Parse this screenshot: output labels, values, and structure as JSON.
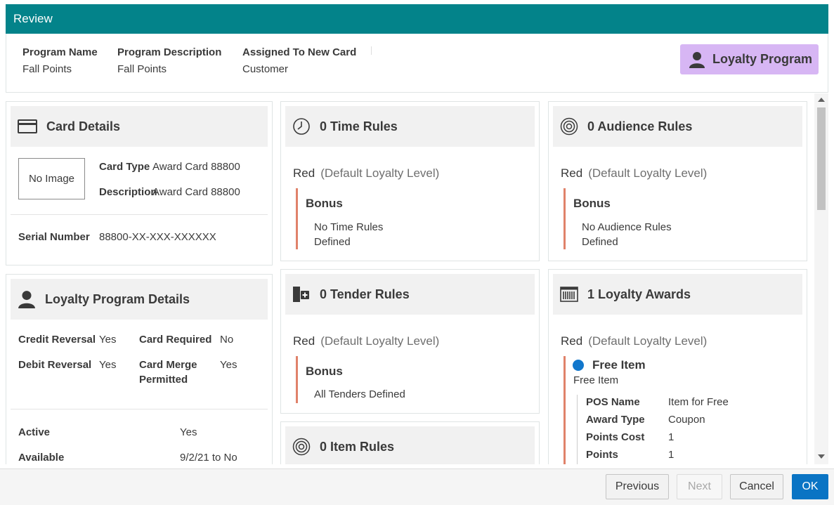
{
  "dialog": {
    "title": "Review"
  },
  "summary": {
    "program_name_label": "Program Name",
    "program_name": "Fall Points",
    "program_description_label": "Program Description",
    "program_description": "Fall Points",
    "assigned_label": "Assigned To New Card",
    "assigned_value": "Customer",
    "badge_label": "Loyalty Program",
    "badge_color": "#d7b6f4"
  },
  "card_details": {
    "title": "Card Details",
    "icon": "credit-card-icon",
    "image_placeholder": "No Image",
    "card_type_label": "Card Type",
    "card_type": "Award Card 88800",
    "description_label": "Description",
    "description": "Award Card 88800",
    "serial_label": "Serial Number",
    "serial": "88800-XX-XXX-XXXXXX"
  },
  "loyalty_details": {
    "title": "Loyalty Program Details",
    "icon": "person-icon",
    "credit_reversal_label": "Credit Reversal",
    "credit_reversal": "Yes",
    "card_required_label": "Card Required",
    "card_required": "No",
    "debit_reversal_label": "Debit Reversal",
    "debit_reversal": "Yes",
    "card_merge_label_1": "Card Merge",
    "card_merge_label_2": "Permitted",
    "card_merge": "Yes",
    "active_label": "Active",
    "active": "Yes",
    "available_label": "Available",
    "available": "9/2/21 to No"
  },
  "time_rules": {
    "title": "0 Time Rules",
    "icon": "clock-icon",
    "level": "Red",
    "level_note": "(Default Loyalty Level)",
    "rule_title": "Bonus",
    "rule_text_1": "No Time Rules",
    "rule_text_2": "Defined"
  },
  "audience_rules": {
    "title": "0 Audience Rules",
    "icon": "target-icon",
    "level": "Red",
    "level_note": "(Default Loyalty Level)",
    "rule_title": "Bonus",
    "rule_text_1": "No Audience Rules",
    "rule_text_2": "Defined"
  },
  "tender_rules": {
    "title": "0 Tender Rules",
    "icon": "tender-icon",
    "level": "Red",
    "level_note": "(Default Loyalty Level)",
    "rule_title": "Bonus",
    "rule_text_1": "All Tenders Defined"
  },
  "loyalty_awards": {
    "title": "1 Loyalty Awards",
    "icon": "barcode-icon",
    "level": "Red",
    "level_note": "(Default Loyalty Level)",
    "award_title": "Free Item",
    "award_subtitle": "Free Item",
    "pos_name_label": "POS Name",
    "pos_name": "Item for Free",
    "award_type_label": "Award Type",
    "award_type": "Coupon",
    "points_cost_label": "Points Cost",
    "points_cost": "1",
    "points_label": "Points",
    "points": "1",
    "dot_color": "#1177cc"
  },
  "item_rules": {
    "title": "0 Item Rules",
    "icon": "target-icon"
  },
  "footer": {
    "previous": "Previous",
    "next": "Next",
    "cancel": "Cancel",
    "ok": "OK"
  },
  "colors": {
    "title_bar": "#03838a",
    "accent_bar": "#e0826a",
    "primary_button": "#0a74c4"
  }
}
